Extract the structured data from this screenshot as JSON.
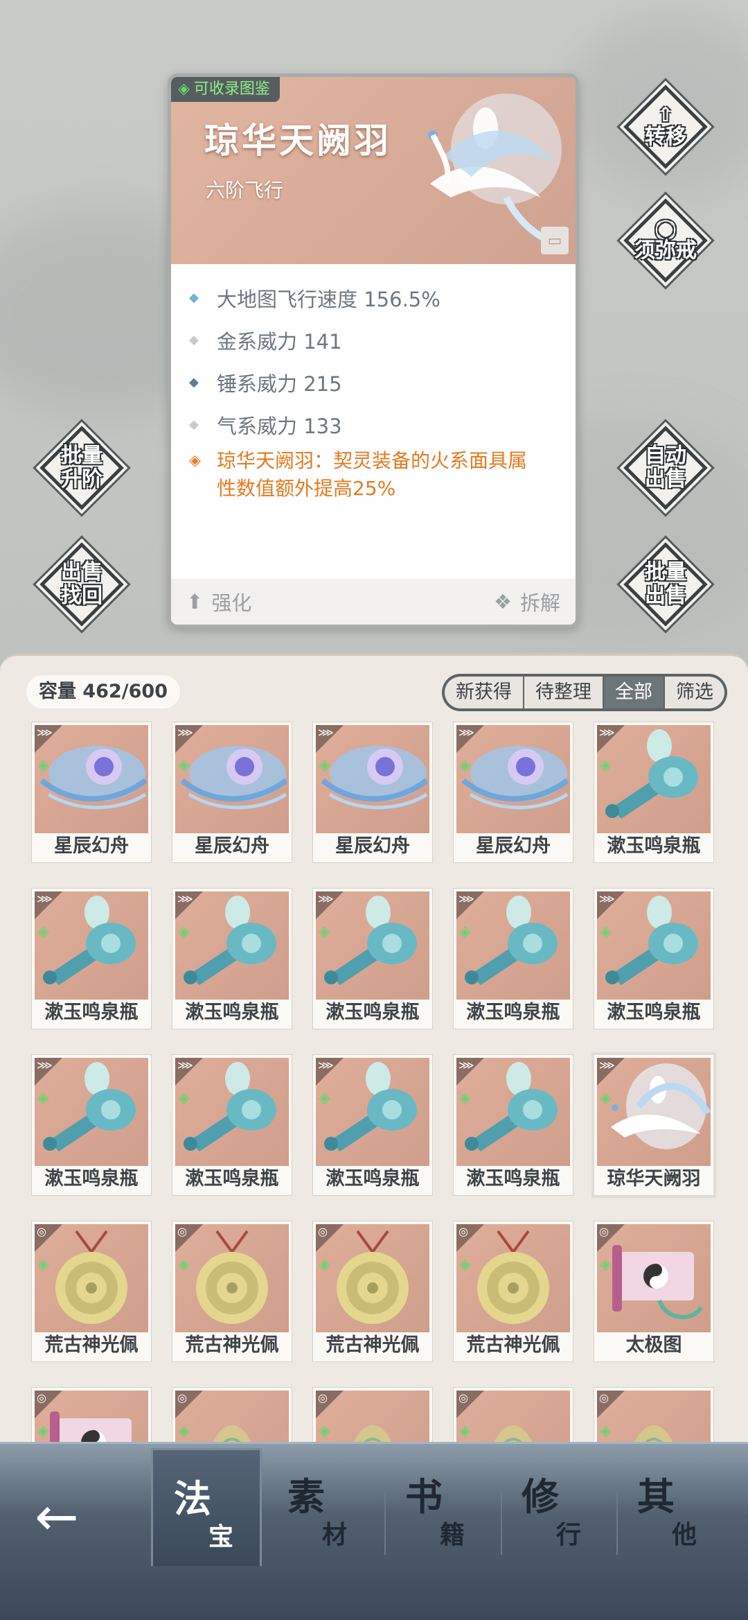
{
  "detail": {
    "collect_tag": "可收录图鉴",
    "name": "琼华天阙羽",
    "type": "六阶飞行",
    "stats": [
      {
        "text": "大地图飞行速度 156.5%",
        "color": "#6fb1da"
      },
      {
        "text": "金系威力 141",
        "color": "#c9c9c9"
      },
      {
        "text": "锤系威力 215",
        "color": "#5f7d94"
      },
      {
        "text": "气系威力 133",
        "color": "#c9c9c9"
      }
    ],
    "bonus_line1": "琼华天阙羽：契灵装备的火系面具属",
    "bonus_line2": "性数值额外提高25%",
    "enhance_label": "强化",
    "dismantle_label": "拆解"
  },
  "side_buttons": {
    "transfer": "转移",
    "ring": "须弥戒",
    "batch_upgrade_1": "批量",
    "batch_upgrade_2": "升阶",
    "auto_sell_1": "自动",
    "auto_sell_2": "出售",
    "sell_recover_1": "出售",
    "sell_recover_2": "找回",
    "batch_sell_1": "批量",
    "batch_sell_2": "出售"
  },
  "inventory": {
    "capacity": "容量 462/600",
    "filters": [
      "新获得",
      "待整理",
      "全部",
      "筛选"
    ],
    "active_filter": "全部",
    "items": [
      {
        "name": "星辰幻舟",
        "art": "boat",
        "badge": "wing-icon"
      },
      {
        "name": "星辰幻舟",
        "art": "boat",
        "badge": "wing-icon"
      },
      {
        "name": "星辰幻舟",
        "art": "boat",
        "badge": "wing-icon"
      },
      {
        "name": "星辰幻舟",
        "art": "boat",
        "badge": "wing-icon"
      },
      {
        "name": "漱玉鸣泉瓶",
        "art": "bottle",
        "badge": "wing-icon"
      },
      {
        "name": "漱玉鸣泉瓶",
        "art": "bottle",
        "badge": "wing-icon"
      },
      {
        "name": "漱玉鸣泉瓶",
        "art": "bottle",
        "badge": "wing-icon"
      },
      {
        "name": "漱玉鸣泉瓶",
        "art": "bottle",
        "badge": "wing-icon"
      },
      {
        "name": "漱玉鸣泉瓶",
        "art": "bottle",
        "badge": "wing-icon"
      },
      {
        "name": "漱玉鸣泉瓶",
        "art": "bottle",
        "badge": "wing-icon"
      },
      {
        "name": "漱玉鸣泉瓶",
        "art": "bottle",
        "badge": "wing-icon"
      },
      {
        "name": "漱玉鸣泉瓶",
        "art": "bottle",
        "badge": "wing-icon"
      },
      {
        "name": "漱玉鸣泉瓶",
        "art": "bottle",
        "badge": "wing-icon"
      },
      {
        "name": "漱玉鸣泉瓶",
        "art": "bottle",
        "badge": "wing-icon"
      },
      {
        "name": "琼华天阙羽",
        "art": "phoenix",
        "badge": "wing-icon"
      },
      {
        "name": "荒古神光佩",
        "art": "pendant",
        "badge": "swirl-icon"
      },
      {
        "name": "荒古神光佩",
        "art": "pendant",
        "badge": "swirl-icon"
      },
      {
        "name": "荒古神光佩",
        "art": "pendant",
        "badge": "swirl-icon"
      },
      {
        "name": "荒古神光佩",
        "art": "pendant",
        "badge": "swirl-icon"
      },
      {
        "name": "太极图",
        "art": "scroll",
        "badge": "swirl-icon"
      },
      {
        "name": "",
        "art": "scroll",
        "badge": "swirl-icon"
      },
      {
        "name": "",
        "art": "bell",
        "badge": "swirl-icon"
      },
      {
        "name": "",
        "art": "bell",
        "badge": "swirl-icon"
      },
      {
        "name": "",
        "art": "bell",
        "badge": "swirl-icon"
      },
      {
        "name": "",
        "art": "bell",
        "badge": "swirl-icon"
      }
    ]
  },
  "nav": {
    "back": "←",
    "tabs": [
      {
        "big": "法",
        "small": "宝"
      },
      {
        "big": "素",
        "small": "材"
      },
      {
        "big": "书",
        "small": "籍"
      },
      {
        "big": "修",
        "small": "行"
      },
      {
        "big": "其",
        "small": "他"
      }
    ]
  }
}
